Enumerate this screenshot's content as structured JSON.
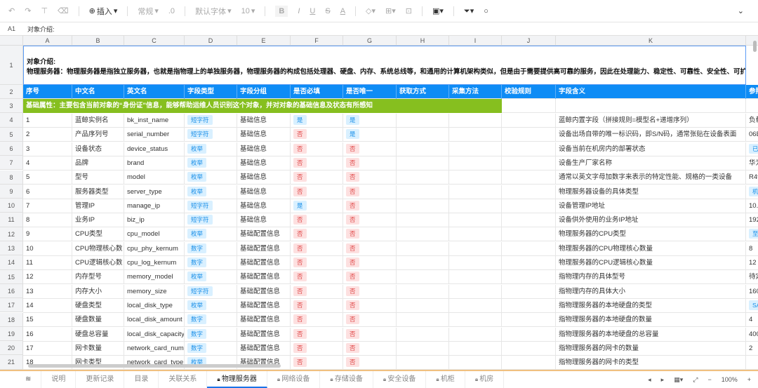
{
  "toolbar": {
    "insert": "插入",
    "format": "常规",
    "decimal": ".0",
    "font": "默认字体",
    "size": "10",
    "bold": "B",
    "italic": "I",
    "underline": "U",
    "strike": "S",
    "color": "A"
  },
  "formula": {
    "cell_ref": "A1",
    "content": "对象介绍:"
  },
  "columns": [
    "A",
    "B",
    "C",
    "D",
    "E",
    "F",
    "G",
    "H",
    "I",
    "J",
    "K"
  ],
  "row_numbers": [
    "1",
    "2",
    "3",
    "4",
    "5",
    "6",
    "7",
    "8",
    "9",
    "10",
    "11",
    "12",
    "13",
    "14",
    "15",
    "16",
    "17",
    "18",
    "19",
    "20",
    "21"
  ],
  "intro": {
    "title": "对象介绍:",
    "text": "物理服务器：物理服务器是指独立服务器，也就是指物理上的单独服务器，物理服务器的构成包括处理器、硬盘、内存、系统总线等，和通用的计算机架构类似，但是由于需要提供高可靠的服务，因此在处理能力、稳定性、可靠性、安全性、可扩展性、可"
  },
  "headers": [
    "序号",
    "中文名",
    "英文名",
    "字段类型",
    "字段分组",
    "是否必填",
    "是否唯一",
    "获取方式",
    "采集方法",
    "校验规则",
    "字段含义",
    "参照"
  ],
  "section": "基础属性：主要包含当前对象的“身份证”信息，能够帮助运维人员识别这个对象，并对对象的基础信息及状态有所感知",
  "rows": [
    [
      "1",
      "蓝鲸实例名",
      "bk_inst_name",
      "短字符",
      "基础信息",
      "是",
      "是",
      "蓝鲸内置字段（拼接规则=模型名+递增序列）",
      "负载"
    ],
    [
      "2",
      "产品序列号",
      "serial_number",
      "短字符",
      "基础信息",
      "否",
      "是",
      "设备出场自带的唯一标识码，即S/N码，通常张贴在设备表面",
      "06E"
    ],
    [
      "3",
      "设备状态",
      "device_status",
      "枚举",
      "基础信息",
      "否",
      "否",
      "设备当前在机房内的部署状态",
      "已"
    ],
    [
      "4",
      "品牌",
      "brand",
      "枚举",
      "基础信息",
      "否",
      "否",
      "设备生产厂家名称",
      "华为"
    ],
    [
      "5",
      "型号",
      "model",
      "枚举",
      "基础信息",
      "否",
      "否",
      "通常以英文字母加数字来表示的特定性能、规格的一类设备",
      "R49"
    ],
    [
      "6",
      "服务器类型",
      "server_type",
      "枚举",
      "基础信息",
      "否",
      "否",
      "物理服务器设备的具体类型",
      "机"
    ],
    [
      "7",
      "管理IP",
      "manage_ip",
      "短字符",
      "基础信息",
      "是",
      "否",
      "设备管理IP地址",
      "10."
    ],
    [
      "8",
      "业务IP",
      "biz_ip",
      "短字符",
      "基础信息",
      "否",
      "否",
      "设备供外使用的业务IP地址",
      "192"
    ],
    [
      "9",
      "CPU类型",
      "cpu_model",
      "枚举",
      "基础配置信息",
      "否",
      "否",
      "物理服务器的CPU类型",
      "至"
    ],
    [
      "10",
      "CPU物理核心数",
      "cpu_phy_kernum",
      "数字",
      "基础配置信息",
      "否",
      "否",
      "物理服务器的CPU物理核心数量",
      "8"
    ],
    [
      "11",
      "CPU逻辑核心数",
      "cpu_log_kernum",
      "数字",
      "基础配置信息",
      "否",
      "否",
      "物理服务器的CPU逻辑核心数量",
      "12"
    ],
    [
      "12",
      "内存型号",
      "memory_model",
      "枚举",
      "基础配置信息",
      "否",
      "否",
      "指物理内存的具体型号",
      "待定"
    ],
    [
      "13",
      "内存大小",
      "memory_size",
      "短字符",
      "基础配置信息",
      "否",
      "否",
      "指物理内存的具体大小",
      "160"
    ],
    [
      "14",
      "硬盘类型",
      "local_disk_type",
      "枚举",
      "基础配置信息",
      "否",
      "否",
      "指物理服务器的本地硬盘的类型",
      "SA"
    ],
    [
      "15",
      "硬盘数量",
      "local_disk_amount",
      "数字",
      "基础配置信息",
      "否",
      "否",
      "指物理服务器的本地硬盘的数量",
      "4"
    ],
    [
      "16",
      "硬盘总容量",
      "local_disk_capacity",
      "数字",
      "基础配置信息",
      "否",
      "否",
      "指物理服务器的本地硬盘的总容量",
      "400"
    ],
    [
      "17",
      "网卡数量",
      "network_card_nums",
      "数字",
      "基础配置信息",
      "否",
      "否",
      "指物理服务器的网卡的数量",
      "2"
    ],
    [
      "18",
      "网卡类型",
      "network_card_type",
      "枚举",
      "基础配置信息",
      "否",
      "否",
      "指物理服务器的网卡的类型",
      ""
    ]
  ],
  "tags_in_ref_col": [
    3,
    6,
    9,
    14,
    18
  ],
  "sheets": [
    "说明",
    "更新记录",
    "目录",
    "关联关系",
    "物理服务器",
    "网络设备",
    "存储设备",
    "安全设备",
    "机柜",
    "机房"
  ],
  "locked_sheets": [
    4,
    5,
    6,
    7,
    8,
    9
  ],
  "active_sheet": 4,
  "zoom": "100%",
  "colors": {
    "header": "#0e8cf5",
    "section": "#86bf1f",
    "yes": "#1a8fe8",
    "no": "#e04848"
  }
}
